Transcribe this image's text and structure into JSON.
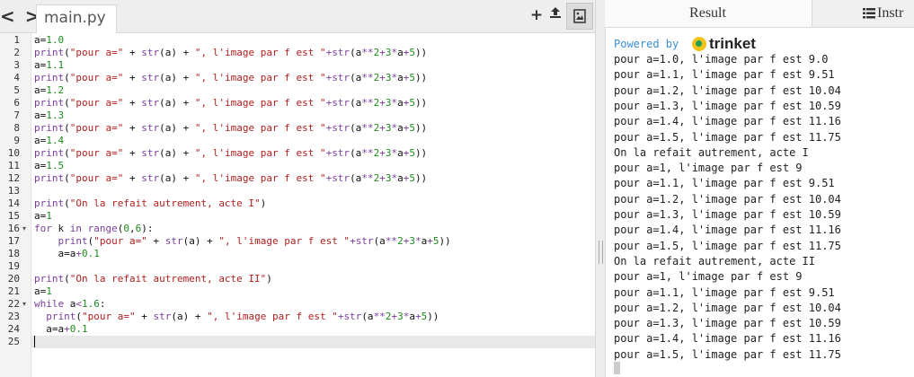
{
  "editor": {
    "nav_arrows": "< >",
    "file_tab": "main.py",
    "toolbar": {
      "add_icon": "+",
      "upload_icon": "⇪",
      "image_icon": "▣"
    },
    "active_line": 25,
    "lines": [
      "a=1.0",
      "print(\"pour a=\" + str(a) + \", l'image par f est \"+str(a**2+3*a+5))",
      "a=1.1",
      "print(\"pour a=\" + str(a) + \", l'image par f est \"+str(a**2+3*a+5))",
      "a=1.2",
      "print(\"pour a=\" + str(a) + \", l'image par f est \"+str(a**2+3*a+5))",
      "a=1.3",
      "print(\"pour a=\" + str(a) + \", l'image par f est \"+str(a**2+3*a+5))",
      "a=1.4",
      "print(\"pour a=\" + str(a) + \", l'image par f est \"+str(a**2+3*a+5))",
      "a=1.5",
      "print(\"pour a=\" + str(a) + \", l'image par f est \"+str(a**2+3*a+5))",
      "",
      "print(\"On la refait autrement, acte I\")",
      "a=1",
      "for k in range(0,6):",
      "    print(\"pour a=\" + str(a) + \", l'image par f est \"+str(a**2+3*a+5))",
      "    a=a+0.1",
      "",
      "print(\"On la refait autrement, acte II\")",
      "a=1",
      "while a<1.6:",
      "  print(\"pour a=\" + str(a) + \", l'image par f est \"+str(a**2+3*a+5))",
      "  a=a+0.1",
      ""
    ],
    "fold_lines": [
      16,
      22
    ]
  },
  "result_panel": {
    "tab_result": "Result",
    "tab_instructions": "Instr",
    "instructions_icon": "list-icon",
    "powered_by": "Powered by",
    "brand": "trinket",
    "output": [
      "pour a=1.0, l'image par f est 9.0",
      "pour a=1.1, l'image par f est 9.51",
      "pour a=1.2, l'image par f est 10.04",
      "pour a=1.3, l'image par f est 10.59",
      "pour a=1.4, l'image par f est 11.16",
      "pour a=1.5, l'image par f est 11.75",
      "On la refait autrement, acte I",
      "pour a=1, l'image par f est 9",
      "pour a=1.1, l'image par f est 9.51",
      "pour a=1.2, l'image par f est 10.04",
      "pour a=1.3, l'image par f est 10.59",
      "pour a=1.4, l'image par f est 11.16",
      "pour a=1.5, l'image par f est 11.75",
      "On la refait autrement, acte II",
      "pour a=1, l'image par f est 9",
      "pour a=1.1, l'image par f est 9.51",
      "pour a=1.2, l'image par f est 10.04",
      "pour a=1.3, l'image par f est 10.59",
      "pour a=1.4, l'image par f est 11.16",
      "pour a=1.5, l'image par f est 11.75"
    ]
  },
  "colors": {
    "keyword": "#7a3e9d",
    "string": "#b21e1e",
    "number": "#1d8a1d",
    "link": "#3a8fd6"
  }
}
